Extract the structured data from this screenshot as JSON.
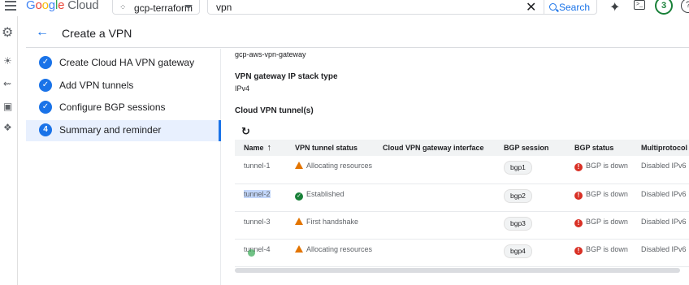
{
  "topbar": {
    "brand": "Google Cloud",
    "project": "gcp-terraform",
    "search_value": "vpn",
    "search_button": "Search",
    "notifications": "3"
  },
  "header": {
    "title": "Create a VPN"
  },
  "stepper": {
    "steps": [
      {
        "label": "Create Cloud HA VPN gateway",
        "state": "done"
      },
      {
        "label": "Add VPN tunnels",
        "state": "done"
      },
      {
        "label": "Configure BGP sessions",
        "state": "done"
      },
      {
        "label": "Summary and reminder",
        "number": "4",
        "state": "active"
      }
    ]
  },
  "content": {
    "gateway_name": "gcp-aws-vpn-gateway",
    "stack_type_label": "VPN gateway IP stack type",
    "stack_type_value": "IPv4",
    "tunnels_label": "Cloud VPN tunnel(s)"
  },
  "table": {
    "columns": [
      "Name",
      "VPN tunnel status",
      "Cloud VPN gateway interface",
      "BGP session",
      "BGP status",
      "Multiprotocol BG"
    ],
    "rows": [
      {
        "name": "tunnel-1",
        "status": "Allocating resources",
        "status_icon": "warning-icon",
        "interface": "",
        "bgp_session": "bgp1",
        "bgp_status": "BGP is down",
        "multiprotocol": "Disabled IPv6"
      },
      {
        "name": "tunnel-2",
        "status": "Established",
        "status_icon": "check-icon",
        "interface": "",
        "bgp_session": "bgp2",
        "bgp_status": "BGP is down",
        "multiprotocol": "Disabled IPv6"
      },
      {
        "name": "tunnel-3",
        "status": "First handshake",
        "status_icon": "warning-icon",
        "interface": "",
        "bgp_session": "bgp3",
        "bgp_status": "BGP is down",
        "multiprotocol": "Disabled IPv6"
      },
      {
        "name": "tunnel-4",
        "status": "Allocating resources",
        "status_icon": "warning-icon",
        "interface": "",
        "bgp_session": "bgp4",
        "bgp_status": "BGP is down",
        "multiprotocol": "Disabled IPv6"
      }
    ]
  },
  "colors": {
    "accent": "#1a73e8",
    "warning": "#e37400",
    "success": "#188038",
    "error": "#d93025"
  }
}
